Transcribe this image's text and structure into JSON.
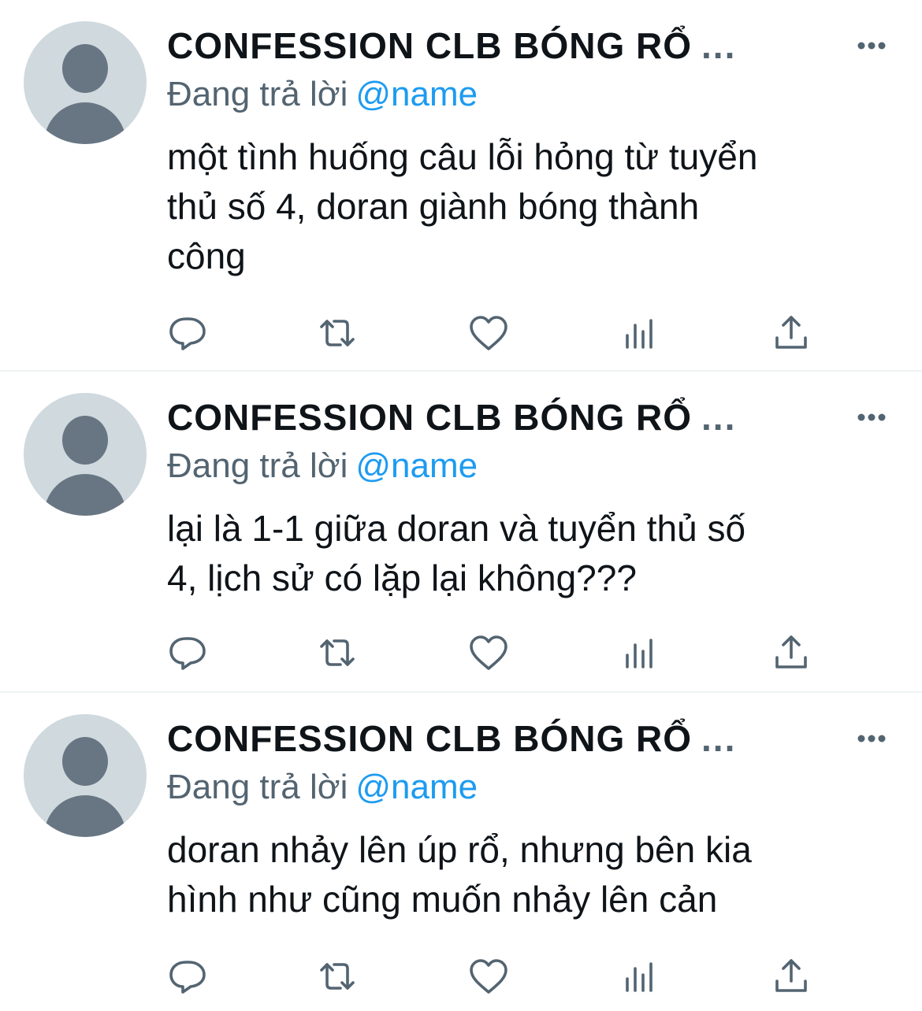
{
  "tweets": [
    {
      "author": "CONFESSION CLB BÓNG RỔ",
      "ellipsis": "...",
      "reply_prefix": "Đang trả lời",
      "mention": "@name",
      "text": "một tình huống câu lỗi hỏng từ tuyển\nthủ số 4, doran giành bóng thành\ncông",
      "actions": [
        "reply-icon",
        "retweet-icon",
        "like-icon",
        "views-icon",
        "share-icon"
      ]
    },
    {
      "author": "CONFESSION CLB BÓNG RỔ",
      "ellipsis": "...",
      "reply_prefix": "Đang trả lời",
      "mention": "@name",
      "text": "lại là 1-1 giữa doran và tuyển thủ số\n4, lịch sử có lặp lại không???",
      "actions": [
        "reply-icon",
        "retweet-icon",
        "like-icon",
        "views-icon",
        "share-icon"
      ]
    },
    {
      "author": "CONFESSION CLB BÓNG RỔ",
      "ellipsis": "...",
      "reply_prefix": "Đang trả lời",
      "mention": "@name",
      "text": "doran nhảy lên úp rổ, nhưng bên kia\nhình như cũng muốn nhảy lên cản",
      "actions": [
        "reply-icon",
        "retweet-icon",
        "like-icon",
        "views-icon",
        "share-icon"
      ]
    }
  ],
  "colors": {
    "text": "#0f1419",
    "secondary": "#536471",
    "link": "#1d9bf0",
    "avatar_bg": "#cfd9de",
    "avatar_fg": "#687684",
    "divider": "#eff3f4"
  }
}
